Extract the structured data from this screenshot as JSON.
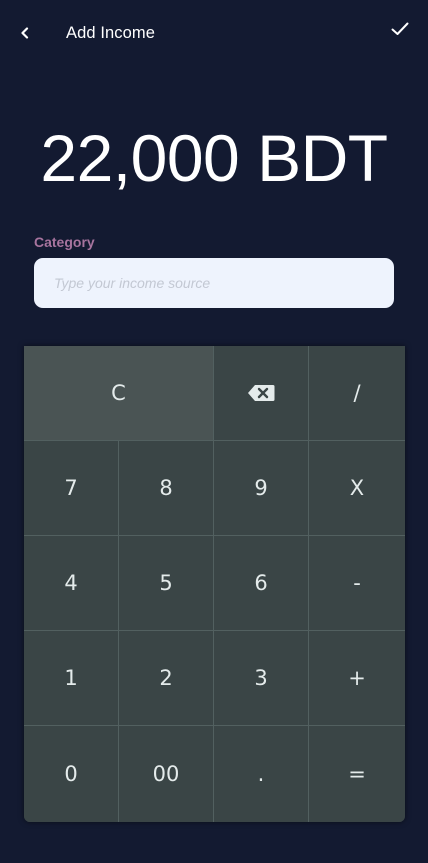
{
  "header": {
    "title": "Add Income",
    "back_icon": "chevron-left-icon",
    "confirm_icon": "checkmark-icon"
  },
  "amount": {
    "display": "22,000 BDT"
  },
  "category": {
    "label": "Category",
    "value": "",
    "placeholder": "Type your income source"
  },
  "keypad": {
    "clear": "C",
    "backspace_icon": "backspace-icon",
    "divide": "/",
    "row2": [
      "7",
      "8",
      "9",
      "X"
    ],
    "row3": [
      "4",
      "5",
      "6",
      "-"
    ],
    "row4": [
      "1",
      "2",
      "3",
      "+"
    ],
    "row5": [
      "0",
      "00",
      ".",
      "="
    ]
  },
  "colors": {
    "background": "#131a31",
    "label_accent": "#a7749e",
    "input_background": "#eef3fd",
    "keypad_background": "#3a4546",
    "clear_key_background": "#4a5454"
  }
}
